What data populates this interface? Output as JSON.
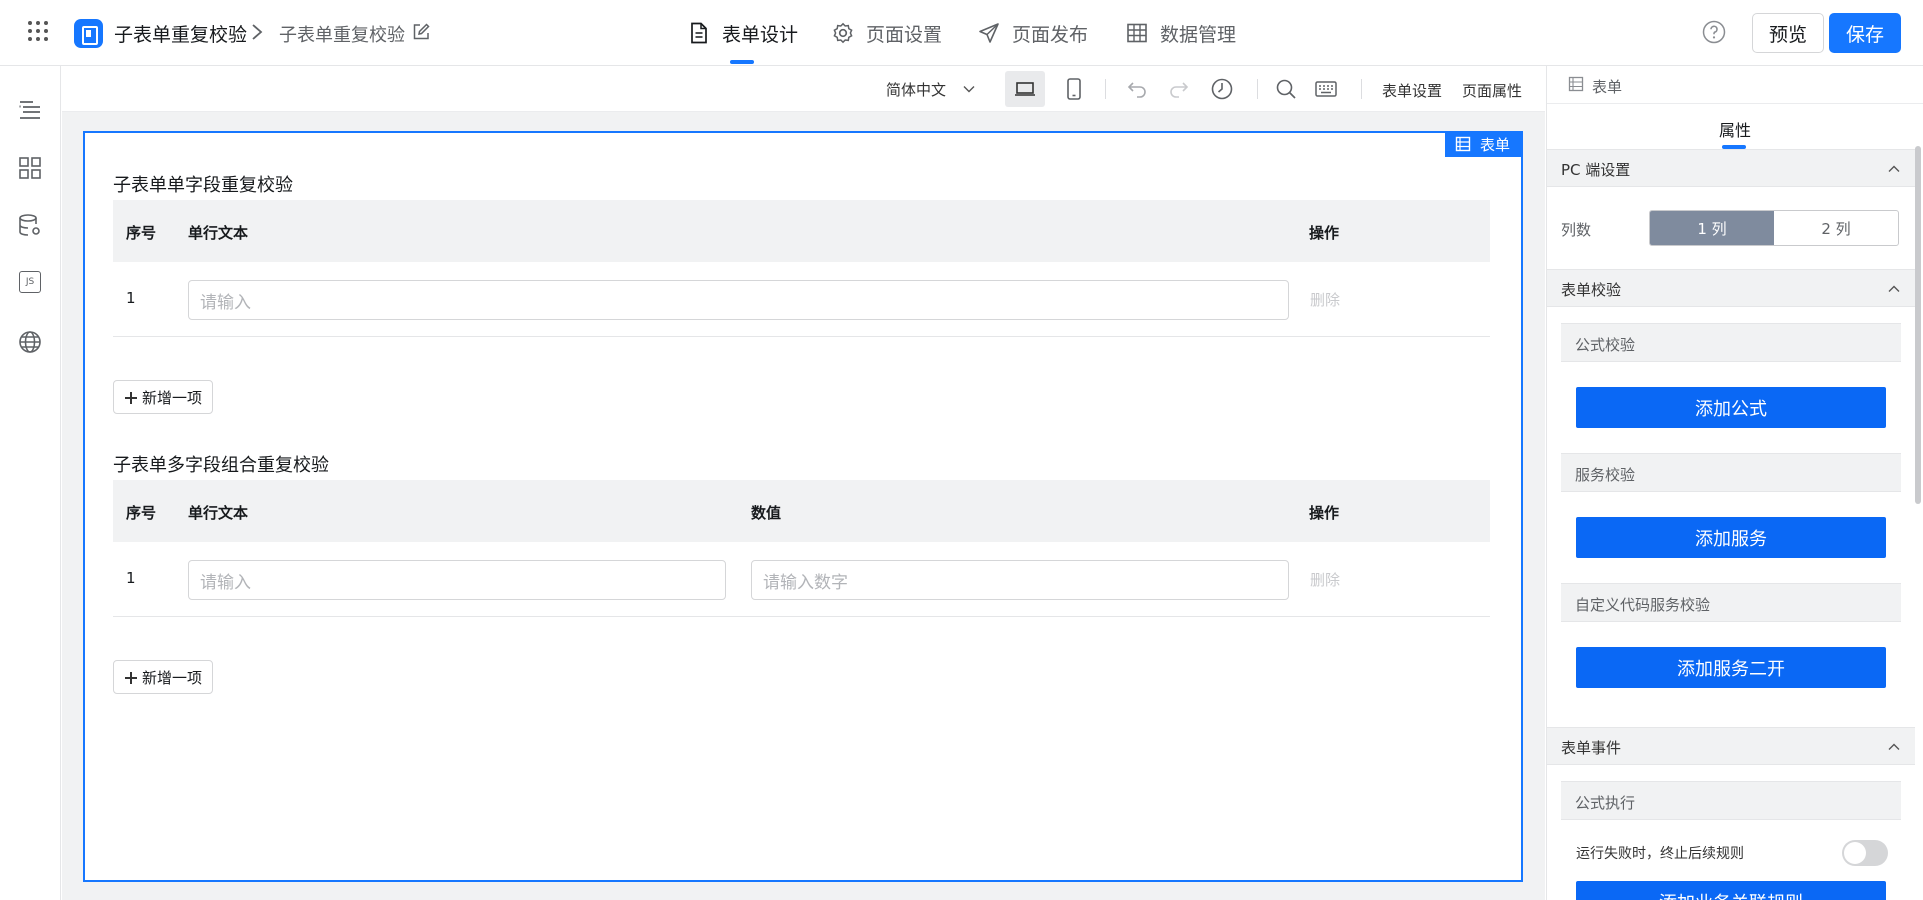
{
  "header": {
    "app_title": "子表单重复校验",
    "page_title": "子表单重复校验",
    "nav_tabs": [
      {
        "label": "表单设计",
        "icon": "file-text-icon",
        "active": true
      },
      {
        "label": "页面设置",
        "icon": "gear-icon",
        "active": false
      },
      {
        "label": "页面发布",
        "icon": "send-icon",
        "active": false
      },
      {
        "label": "数据管理",
        "icon": "table-icon",
        "active": false
      }
    ],
    "preview_label": "预览",
    "save_label": "保存",
    "accent_color": "#1677ff"
  },
  "left_rail": {
    "icons": [
      "outline-icon",
      "component-library-icon",
      "data-source-icon",
      "js-code-icon",
      "globe-icon"
    ],
    "js_icon_text": "JS"
  },
  "toolbar": {
    "language": "简体中文",
    "form_settings_label": "表单设置",
    "page_props_label": "页面属性",
    "icons": [
      "desktop-icon",
      "mobile-icon",
      "undo-icon",
      "redo-icon",
      "history-icon",
      "search-icon",
      "keyboard-icon"
    ]
  },
  "canvas": {
    "form_tag": "表单",
    "sections": [
      {
        "title": "子表单单字段重复校验",
        "headers": {
          "index": "序号",
          "col1": "单行文本",
          "col2": "",
          "action": "操作"
        },
        "rows": [
          {
            "index": "1",
            "col1_placeholder": "请输入",
            "delete_label": "删除"
          }
        ],
        "add_label": "新增一项"
      },
      {
        "title": "子表单多字段组合重复校验",
        "headers": {
          "index": "序号",
          "col1": "单行文本",
          "col2": "数值",
          "action": "操作"
        },
        "rows": [
          {
            "index": "1",
            "col1_placeholder": "请输入",
            "col2_placeholder": "请输入数字",
            "delete_label": "删除"
          }
        ],
        "add_label": "新增一项"
      }
    ]
  },
  "right_panel": {
    "header": "表单",
    "tab": "属性",
    "pc_settings": {
      "title": "PC 端设置",
      "columns_label": "列数",
      "options": [
        "1 列",
        "2 列"
      ],
      "selected": "1 列"
    },
    "form_validation": {
      "title": "表单校验",
      "formula_title": "公式校验",
      "formula_button": "添加公式",
      "service_title": "服务校验",
      "service_button": "添加服务",
      "custom_title": "自定义代码服务校验",
      "custom_button": "添加服务二开"
    },
    "form_events": {
      "title": "表单事件",
      "formula_exec_title": "公式执行",
      "stop_on_fail_label": "运行失败时，终止后续规则",
      "stop_on_fail_enabled": false,
      "add_rule_button": "添加业务关联规则"
    }
  }
}
